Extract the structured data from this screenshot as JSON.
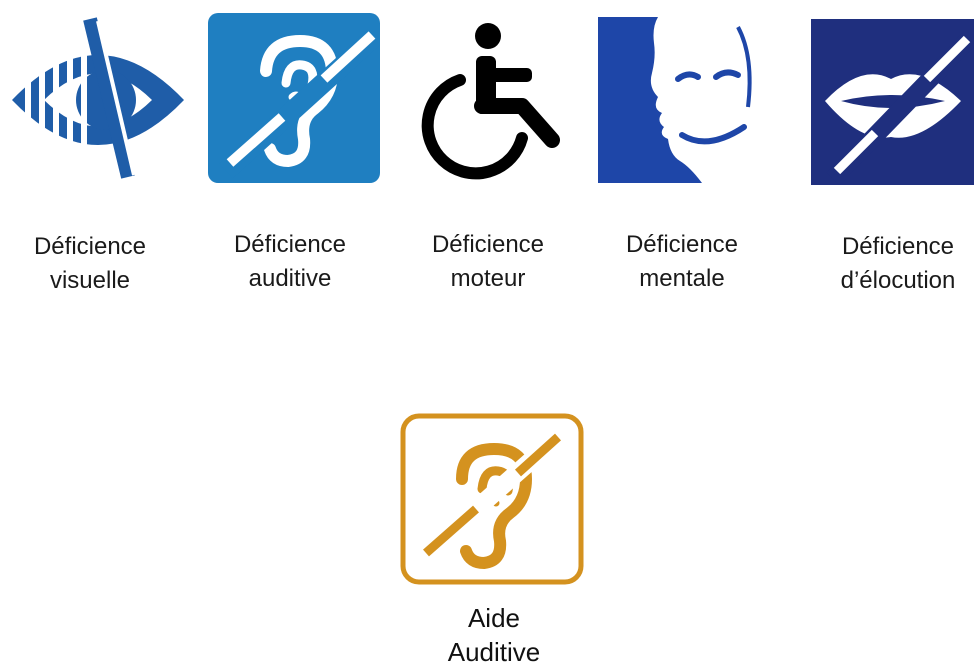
{
  "symbols": [
    {
      "icon": "visual-impairment-icon",
      "line1": "Déficience",
      "line2": "visuelle",
      "color": "#1f5da8"
    },
    {
      "icon": "hearing-impairment-icon",
      "line1": "Déficience",
      "line2": "auditive",
      "color": "#1f7fc1"
    },
    {
      "icon": "wheelchair-icon",
      "line1": "Déficience",
      "line2": "moteur",
      "color": "#000000"
    },
    {
      "icon": "mental-impairment-face-icon",
      "line1": "Déficience",
      "line2": "mentale",
      "color": "#1e46a8"
    },
    {
      "icon": "speech-impairment-lips-icon",
      "line1": "Déficience",
      "line2": "d’élocution",
      "color": "#1f2f7e"
    }
  ],
  "hearing_aid": {
    "icon": "hearing-aid-ear-icon",
    "line1": "Aide",
    "line2": "Auditive",
    "color": "#d4921f"
  }
}
